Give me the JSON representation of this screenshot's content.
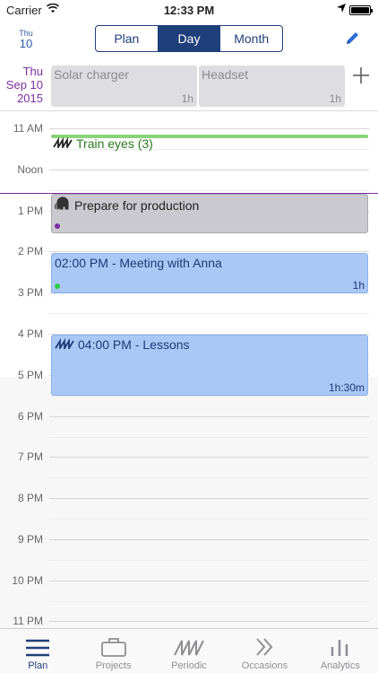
{
  "status_bar": {
    "carrier": "Carrier",
    "time": "12:33 PM"
  },
  "nav": {
    "calendar_dow": "Thu",
    "calendar_day": "10",
    "segments": [
      {
        "label": "Plan",
        "selected": false
      },
      {
        "label": "Day",
        "selected": true
      },
      {
        "label": "Month",
        "selected": false
      }
    ]
  },
  "all_day": {
    "date_dow": "Thu",
    "date_month_day": "Sep 10",
    "date_year": "2015",
    "items": [
      {
        "title": "Solar charger",
        "duration": "1h"
      },
      {
        "title": "Headset",
        "duration": "1h"
      }
    ]
  },
  "timeline": {
    "hours": [
      "11 AM",
      "Noon",
      "1 PM",
      "2 PM",
      "3 PM",
      "4 PM",
      "5 PM",
      "6 PM",
      "7 PM",
      "8 PM",
      "9 PM",
      "10 PM",
      "11 PM"
    ],
    "events": {
      "train": {
        "title": "Train eyes (3)",
        "color": "#8ad27a"
      },
      "prod": {
        "title": "Prepare for production",
        "dot_color": "#7b2ea0"
      },
      "anna": {
        "title": "02:00 PM - Meeting with Anna",
        "duration": "1h",
        "dot_color": "#2ecc40"
      },
      "lessons": {
        "title": "04:00 PM - Lessons",
        "duration": "1h:30m"
      }
    }
  },
  "tabs": [
    {
      "label": "Plan",
      "icon": "plan-icon",
      "active": true
    },
    {
      "label": "Projects",
      "icon": "briefcase-icon",
      "active": false
    },
    {
      "label": "Periodic",
      "icon": "periodic-icon",
      "active": false
    },
    {
      "label": "Occasions",
      "icon": "double-chevron-icon",
      "active": false
    },
    {
      "label": "Analytics",
      "icon": "bars-icon",
      "active": false
    }
  ],
  "colors": {
    "accent": "#1f3f7a",
    "now_line": "#7b2ea0",
    "date": "#7b2ea0"
  }
}
